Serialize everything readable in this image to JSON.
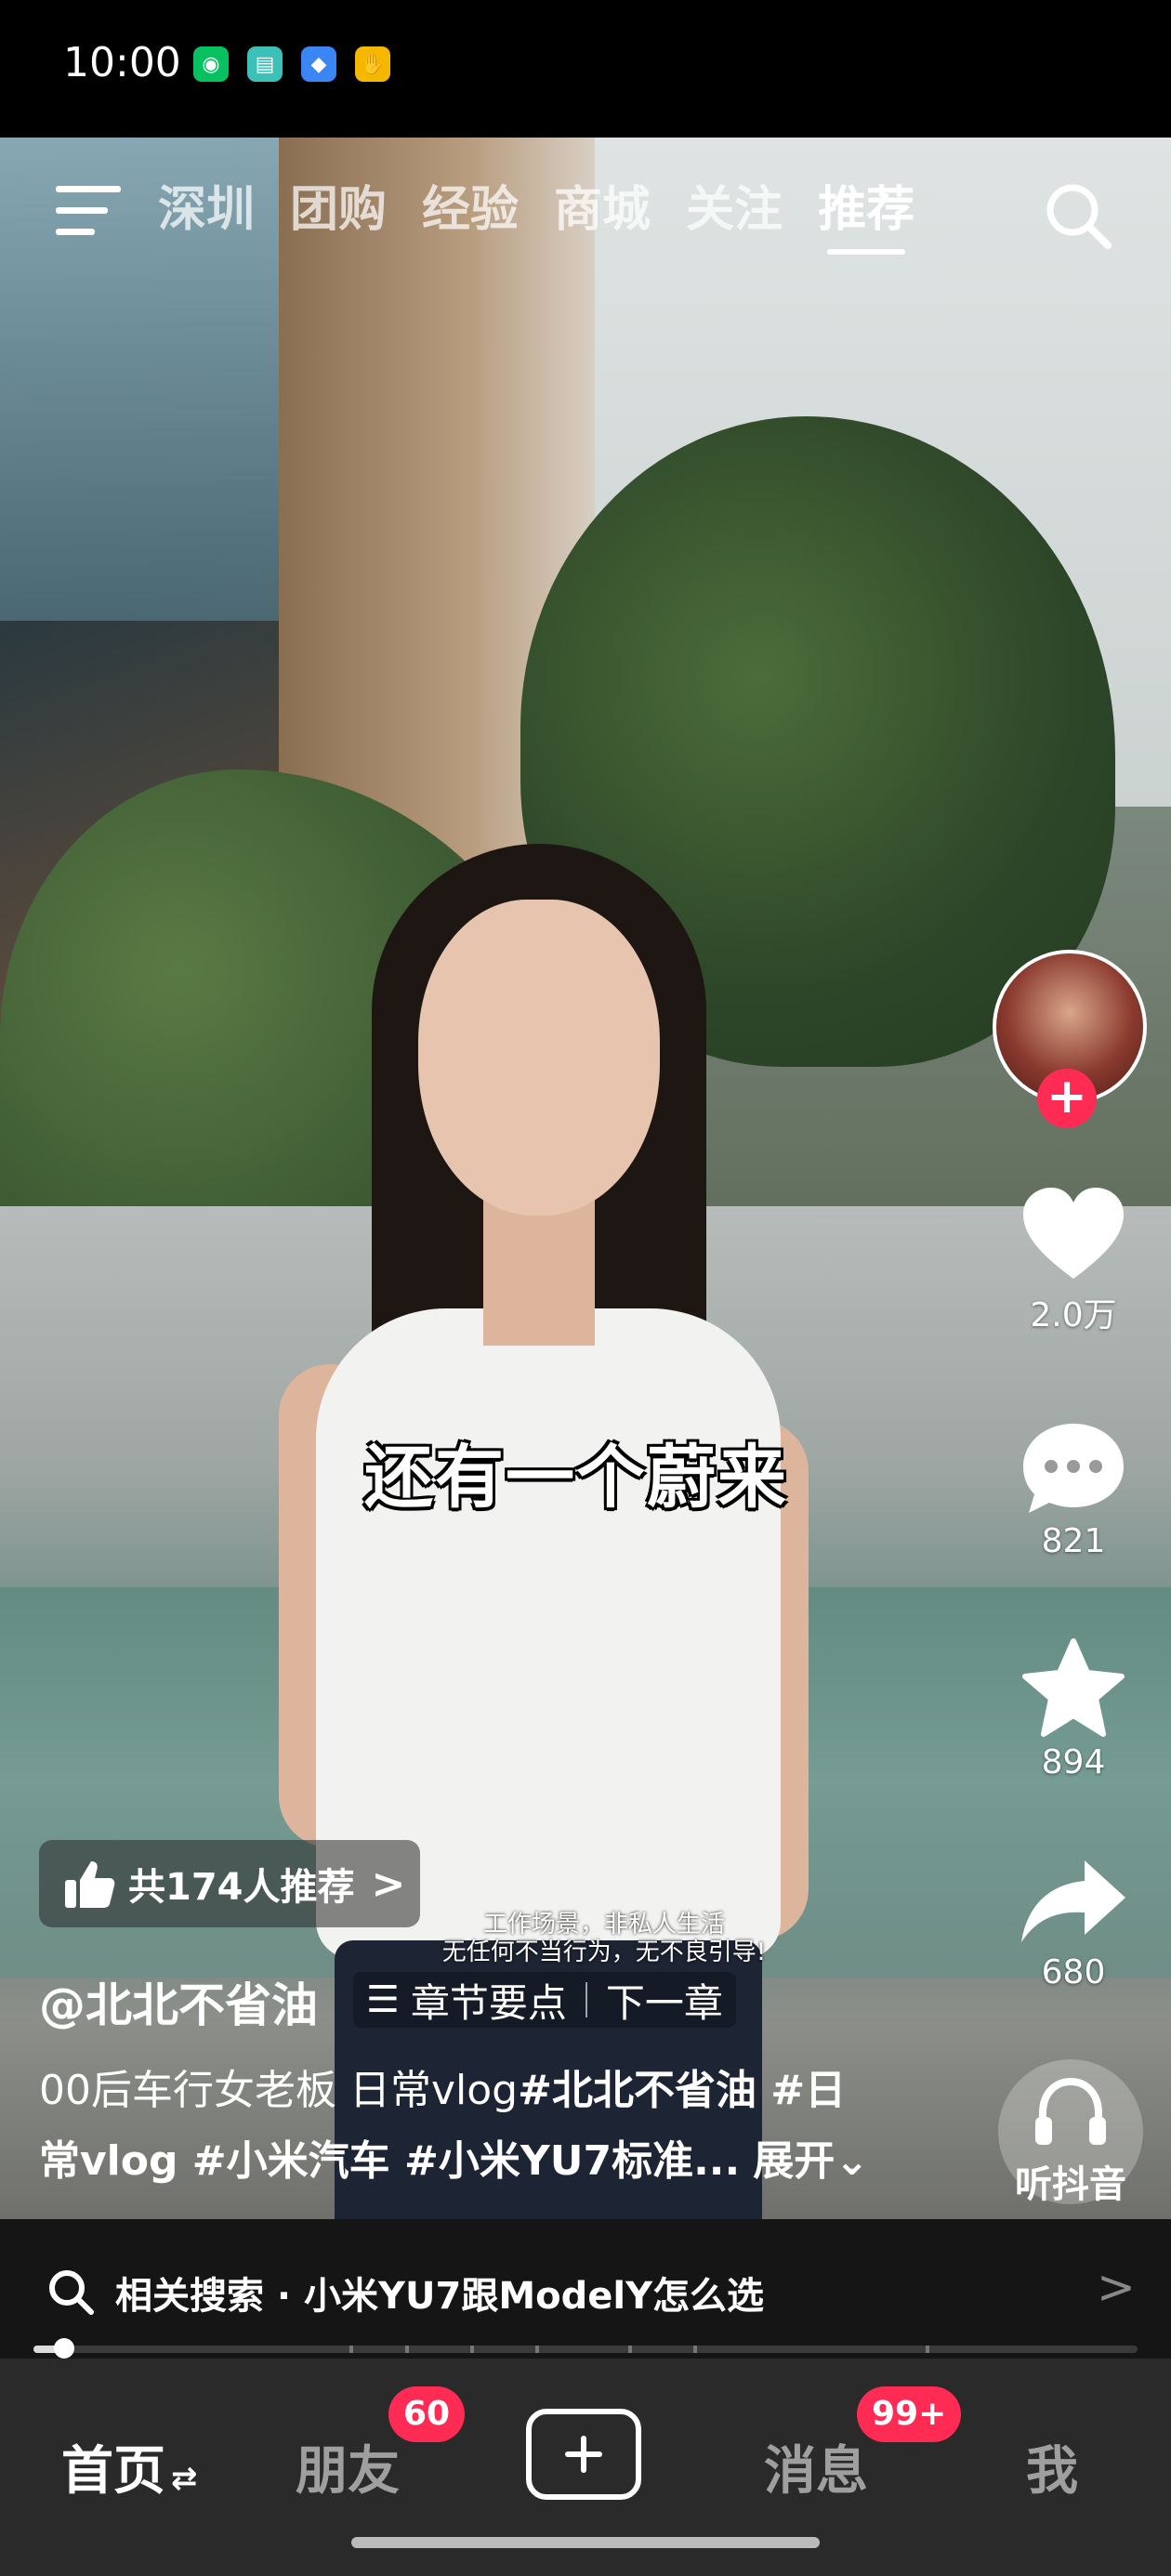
{
  "status_bar": {
    "time": "10:00",
    "icons": [
      {
        "name": "wechat-icon",
        "color": "#07c160"
      },
      {
        "name": "message-icon",
        "color": "#3cc1b8"
      },
      {
        "name": "browser-icon",
        "color": "#3b86f5"
      },
      {
        "name": "hand-icon",
        "color": "#f5b700"
      }
    ]
  },
  "top_nav": {
    "tabs": [
      {
        "label": "深圳",
        "active": false
      },
      {
        "label": "团购",
        "active": false
      },
      {
        "label": "经验",
        "active": false
      },
      {
        "label": "商城",
        "active": false
      },
      {
        "label": "关注",
        "active": false
      },
      {
        "label": "推荐",
        "active": true
      }
    ]
  },
  "video": {
    "caption": "还有一个蔚来",
    "disclaimer_line1": "工作场景，非私人生活",
    "disclaimer_line2": "无任何不当行为，无不良引导!",
    "recommend_label": "共174人推荐",
    "recommend_chevron": ">",
    "author": "@北北不省油",
    "chapter_label": "章节要点",
    "next_chapter_label": "下一章",
    "description_plain": "00后车行女老板 日常vlog",
    "description_tag1": "#北北不省油 #日常vlog #小米汽车 #小米YU7标准...",
    "expand_label": "展开",
    "progress_fraction": 0.025
  },
  "rail": {
    "like_count": "2.0万",
    "comment_count": "821",
    "favorite_count": "894",
    "share_count": "680",
    "listen_label": "听抖音"
  },
  "related_search": {
    "text": "相关搜索 · 小米YU7跟ModelY怎么选",
    "chevron": ">"
  },
  "bottom_nav": {
    "home": "首页",
    "home_suffix": "⇄",
    "friends": "朋友",
    "friends_badge": "60",
    "messages": "消息",
    "messages_badge": "99+",
    "me": "我"
  },
  "colors": {
    "accent": "#fe2c55",
    "nav_background": "#2a2a2a",
    "related_background": "#151515"
  }
}
